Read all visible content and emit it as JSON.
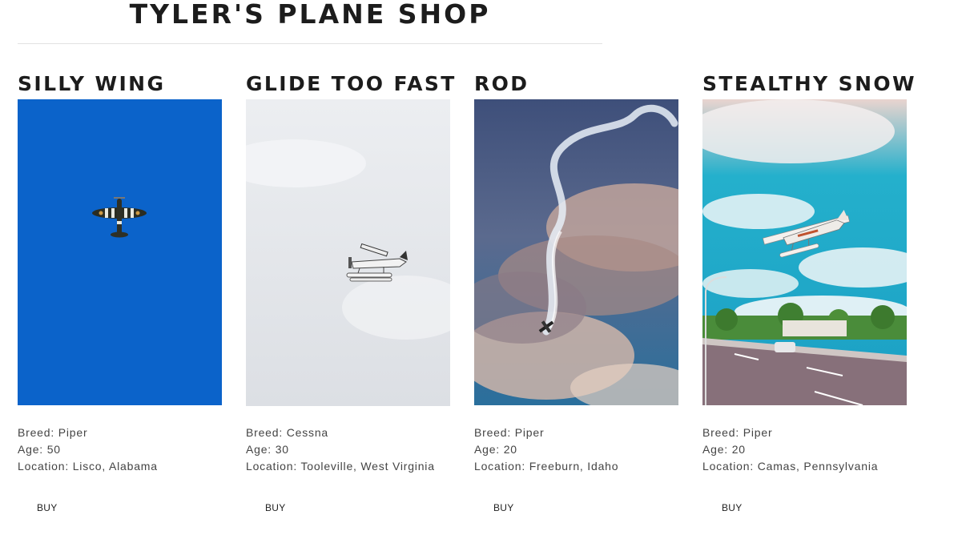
{
  "shop": {
    "title": "TYLER'S PLANE SHOP"
  },
  "planes": [
    {
      "name": "SILLY WING",
      "breed": "Breed: Piper",
      "age": "Age: 50",
      "location": "Location: Lisco, Alabama",
      "buy": "BUY",
      "sky": "#0a5fc4"
    },
    {
      "name": "GLIDE TOO FAST",
      "breed": "Breed: Cessna",
      "age": "Age: 30",
      "location": "Location: Tooleville, West Virginia",
      "buy": "BUY",
      "sky": "#e4e6ea"
    },
    {
      "name": "ROD",
      "breed": "Breed: Piper",
      "age": "Age: 20",
      "location": "Location: Freeburn, Idaho",
      "buy": "BUY",
      "sky": "#4a5f8a"
    },
    {
      "name": "STEALTHY SNOW",
      "breed": "Breed: Piper",
      "age": "Age: 20",
      "location": "Location: Camas, Pennsylvania",
      "buy": "BUY",
      "sky": "#1fa9c9"
    }
  ]
}
